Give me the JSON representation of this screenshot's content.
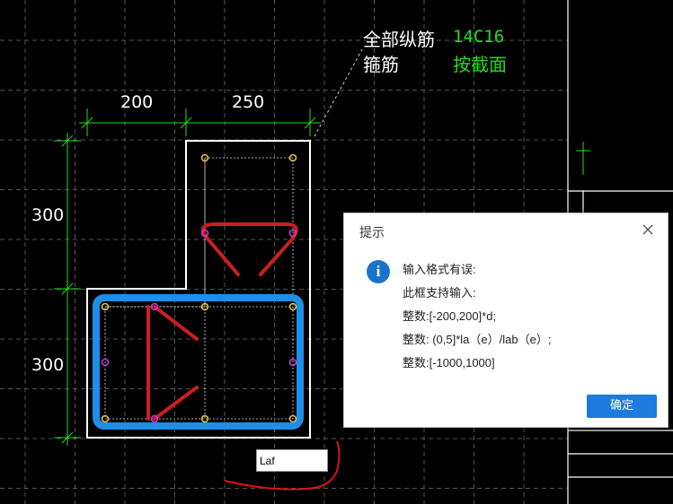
{
  "annotation": {
    "all_longitudinal_label": "全部纵筋",
    "all_longitudinal_value": "14C16",
    "stirrup_label": "箍筋",
    "stirrup_value": "按截面",
    "label_color": "#ffffff",
    "value_color": "#22dd22"
  },
  "dimensions": {
    "top_left": "200",
    "top_right": "250",
    "left_upper": "300",
    "left_lower": "300",
    "dimension_color": "#22dd22"
  },
  "input_box": {
    "value": "Laf"
  },
  "dialog": {
    "title": "提示",
    "icon": "i",
    "lines": [
      "输入格式有误:",
      "此框支持输入:",
      "整数:[-200,200]*d;",
      "整数: (0,5]*la（e）/lab（e）;",
      "整数:[-1000,1000]"
    ],
    "ok_label": "确定",
    "accent_color": "#1f7bdb"
  },
  "colors": {
    "background": "#000000",
    "outline": "#ffffff",
    "stirrup_blue": "#1e8ee8",
    "tie_red": "#cc1f1f",
    "rebar_yellow": "#e3c043",
    "rebar_magenta": "#c43bd6",
    "annotation_red": "#dd1111"
  }
}
